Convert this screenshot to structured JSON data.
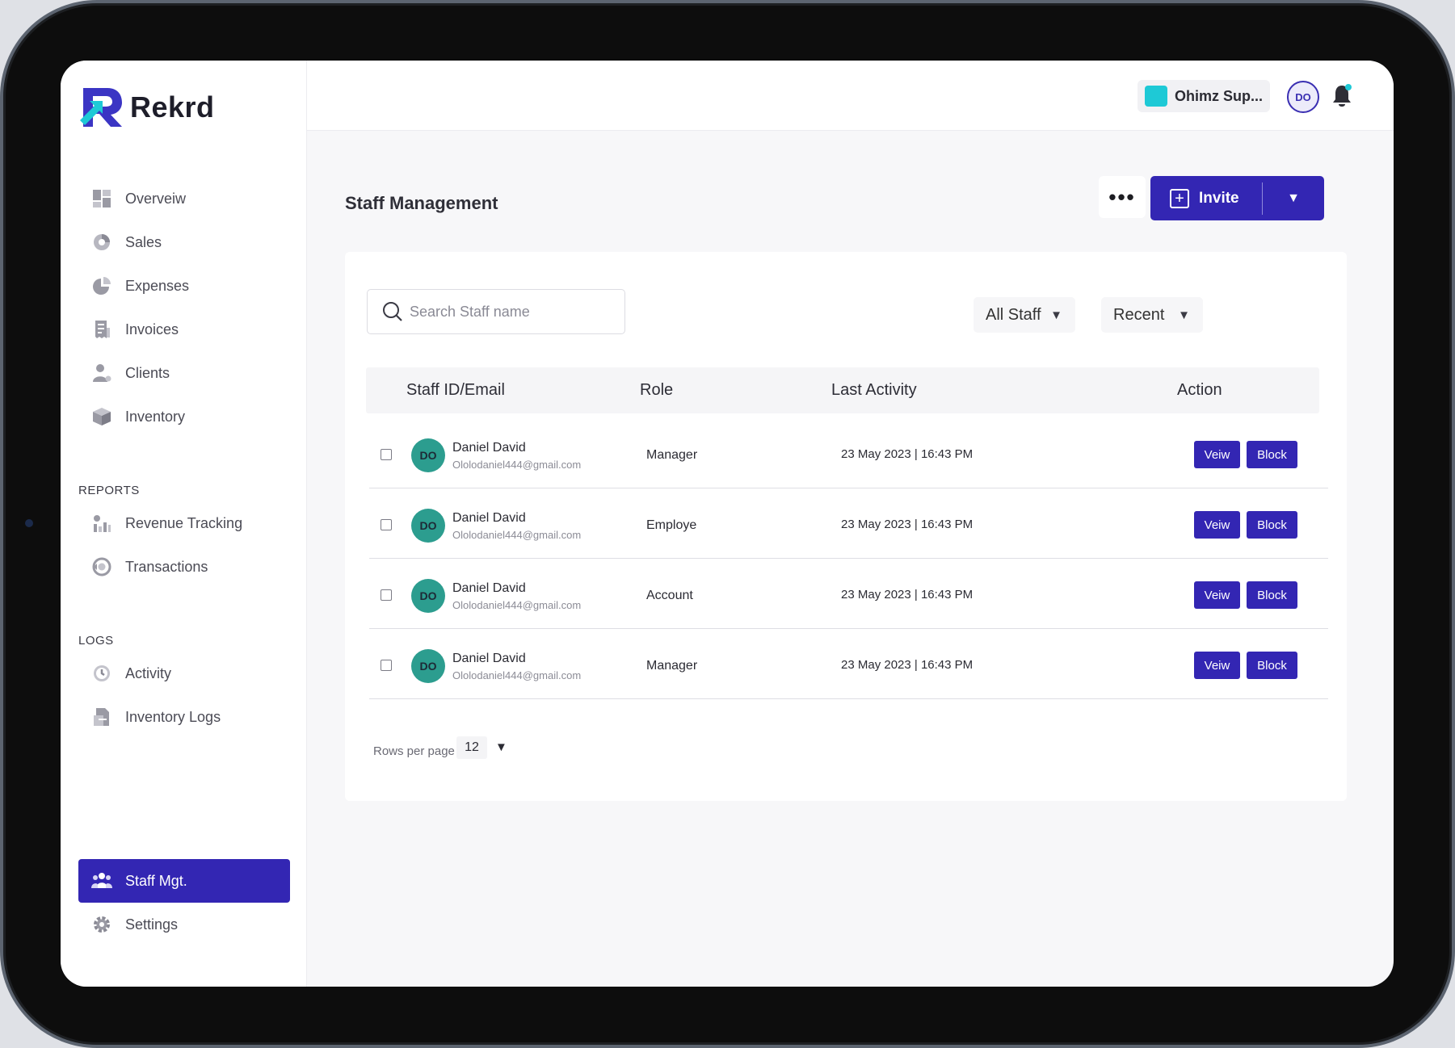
{
  "app": {
    "name": "Rekrd",
    "brand_color": "#3326b3",
    "accent_color": "#1ec9d6"
  },
  "sidebar": {
    "main_items": [
      {
        "label": "Overveiw",
        "icon": "dashboard-grid-icon"
      },
      {
        "label": "Sales",
        "icon": "pie-chart-icon"
      },
      {
        "label": "Expenses",
        "icon": "pie-slice-icon"
      },
      {
        "label": "Invoices",
        "icon": "invoice-icon"
      },
      {
        "label": "Clients",
        "icon": "client-user-icon"
      },
      {
        "label": "Inventory",
        "icon": "box-icon"
      }
    ],
    "reports_label": "REPORTS",
    "reports_items": [
      {
        "label": "Revenue Tracking",
        "icon": "bar-chart-icon"
      },
      {
        "label": "Transactions",
        "icon": "transactions-icon"
      }
    ],
    "logs_label": "LOGS",
    "logs_items": [
      {
        "label": "Activity",
        "icon": "clock-icon"
      },
      {
        "label": "Inventory Logs",
        "icon": "document-icon"
      }
    ],
    "active_item": {
      "label": "Staff Mgt.",
      "icon": "staff-group-icon"
    },
    "settings_item": {
      "label": "Settings",
      "icon": "gear-icon"
    }
  },
  "topbar": {
    "org_name": "Ohimz Sup...",
    "user_initials": "DO"
  },
  "main": {
    "title": "Staff Management",
    "more_label": "•••",
    "invite_label": "Invite",
    "search_placeholder": "Search Staff name",
    "filter_staff": "All Staff",
    "filter_sort": "Recent",
    "columns": [
      "Staff ID/Email",
      "Role",
      "Last Activity",
      "Action"
    ],
    "rows": [
      {
        "initials": "DO",
        "name": "Daniel David",
        "email": "Ololodaniel444@gmail.com",
        "role": "Manager",
        "last_activity": "23 May 2023 | 16:43 PM",
        "view": "Veiw",
        "block": "Block"
      },
      {
        "initials": "DO",
        "name": "Daniel David",
        "email": "Ololodaniel444@gmail.com",
        "role": "Employe",
        "last_activity": "23 May 2023 | 16:43 PM",
        "view": "Veiw",
        "block": "Block"
      },
      {
        "initials": "DO",
        "name": "Daniel David",
        "email": "Ololodaniel444@gmail.com",
        "role": "Account",
        "last_activity": "23 May 2023 | 16:43 PM",
        "view": "Veiw",
        "block": "Block"
      },
      {
        "initials": "DO",
        "name": "Daniel David",
        "email": "Ololodaniel444@gmail.com",
        "role": "Manager",
        "last_activity": "23 May 2023 | 16:43 PM",
        "view": "Veiw",
        "block": "Block"
      }
    ],
    "rows_per_page_label": "Rows per page",
    "rows_per_page_value": "12"
  }
}
